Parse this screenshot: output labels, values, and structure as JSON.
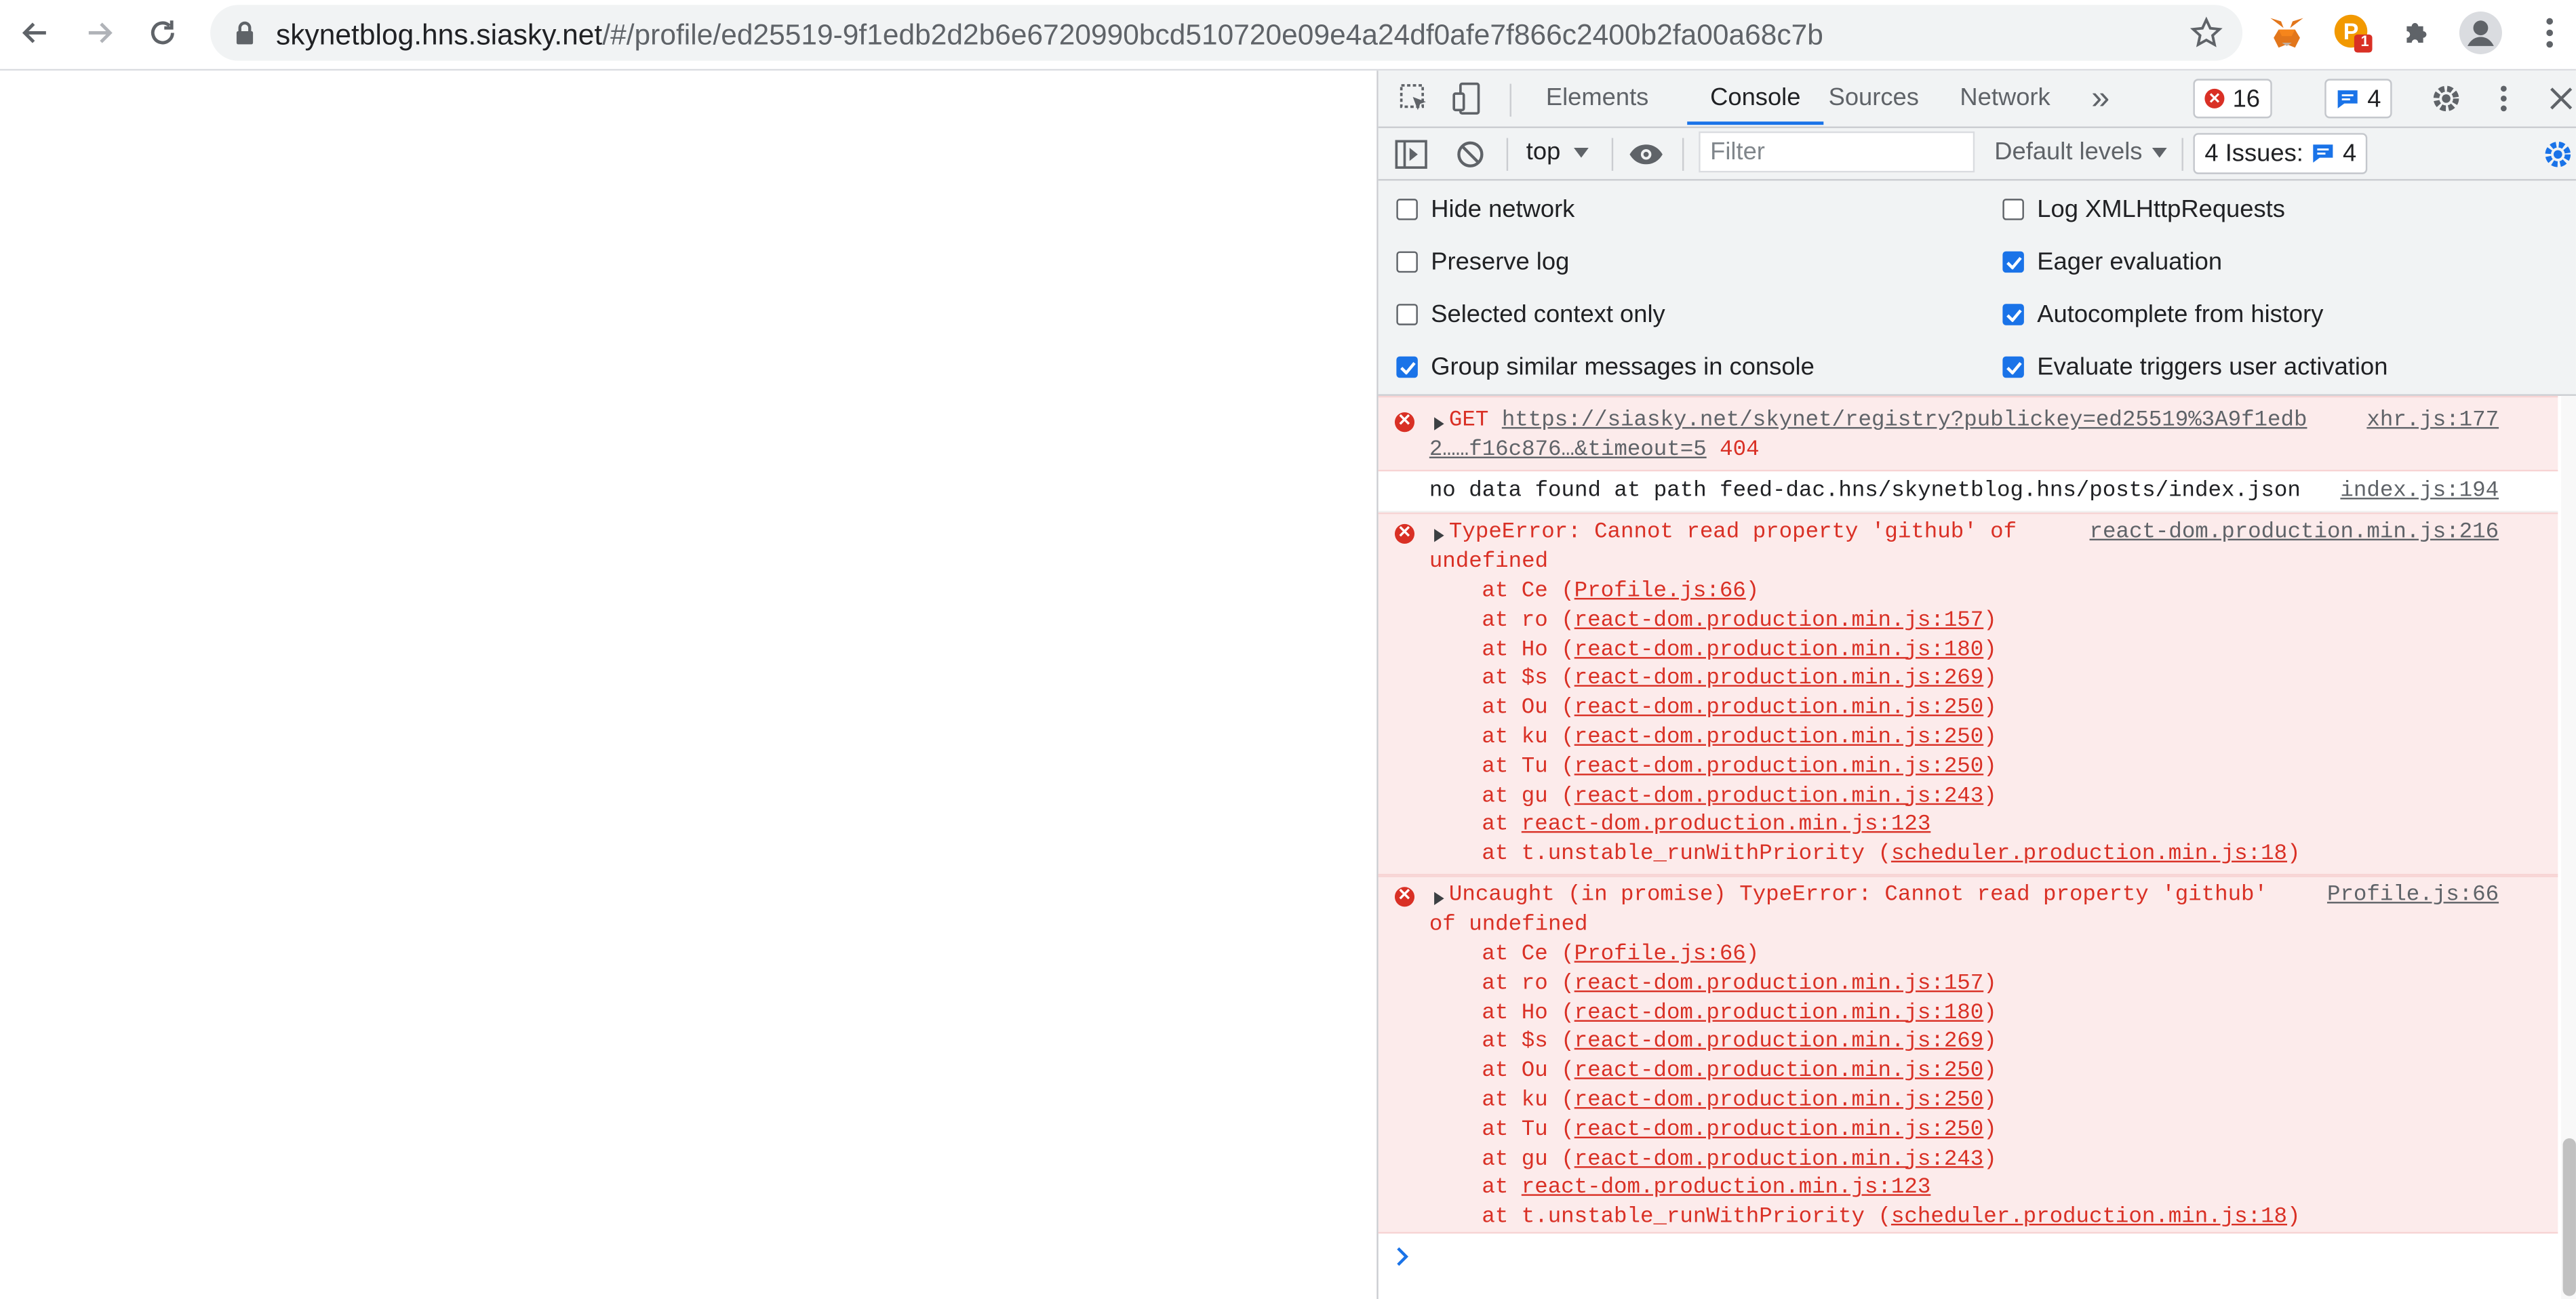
{
  "browser": {
    "url_host": "skynetblog.hns.siasky.net",
    "url_rest": "/#/profile/ed25519-9f1edb2d2b6e6720990bcd510720e09e4a24df0afe7f866c2400b2fa00a68c7b",
    "ext_badge": "1"
  },
  "devtools": {
    "tabs": [
      "Elements",
      "Console",
      "Sources",
      "Network"
    ],
    "more_tabs": "»",
    "error_count": "16",
    "message_count": "4",
    "context": "top",
    "filter_placeholder": "Filter",
    "levels": "Default levels",
    "issues_label": "4 Issues:",
    "issues_count": "4",
    "settings_left": [
      {
        "label": "Hide network",
        "checked": false
      },
      {
        "label": "Preserve log",
        "checked": false
      },
      {
        "label": "Selected context only",
        "checked": false
      },
      {
        "label": "Group similar messages in console",
        "checked": true
      }
    ],
    "settings_right": [
      {
        "label": "Log XMLHttpRequests",
        "checked": false
      },
      {
        "label": "Eager evaluation",
        "checked": true
      },
      {
        "label": "Autocomplete from history",
        "checked": true
      },
      {
        "label": "Evaluate triggers user activation",
        "checked": true
      }
    ]
  },
  "console": {
    "get_error": {
      "method": "GET",
      "url_line1": "https://siasky.net/skynet/registry?publickey=ed25519%3A9f1edb",
      "url_line2": "2……f16c876…&timeout=5",
      "status": "404",
      "source": "xhr.js:177"
    },
    "info": {
      "text": "no data found at path feed-dac.hns/skynetblog.hns/posts/index.json",
      "source": "index.js:194"
    },
    "type_error": {
      "line1": "TypeError: Cannot read property 'github' of",
      "line2": "undefined",
      "source": "react-dom.production.min.js:216"
    },
    "uncaught_error": {
      "line1": "Uncaught (in promise) TypeError: Cannot read property 'github'",
      "line2": "of undefined",
      "source": "Profile.js:66"
    },
    "stack": [
      {
        "fn": "Ce",
        "loc": "Profile.js:66"
      },
      {
        "fn": "ro",
        "loc": "react-dom.production.min.js:157"
      },
      {
        "fn": "Ho",
        "loc": "react-dom.production.min.js:180"
      },
      {
        "fn": "$s",
        "loc": "react-dom.production.min.js:269"
      },
      {
        "fn": "Ou",
        "loc": "react-dom.production.min.js:250"
      },
      {
        "fn": "ku",
        "loc": "react-dom.production.min.js:250"
      },
      {
        "fn": "Tu",
        "loc": "react-dom.production.min.js:250"
      },
      {
        "fn": "gu",
        "loc": "react-dom.production.min.js:243"
      },
      {
        "fn": "",
        "loc": "react-dom.production.min.js:123"
      },
      {
        "fn": "t.unstable_runWithPriority",
        "loc": "scheduler.production.min.js:18"
      }
    ]
  }
}
